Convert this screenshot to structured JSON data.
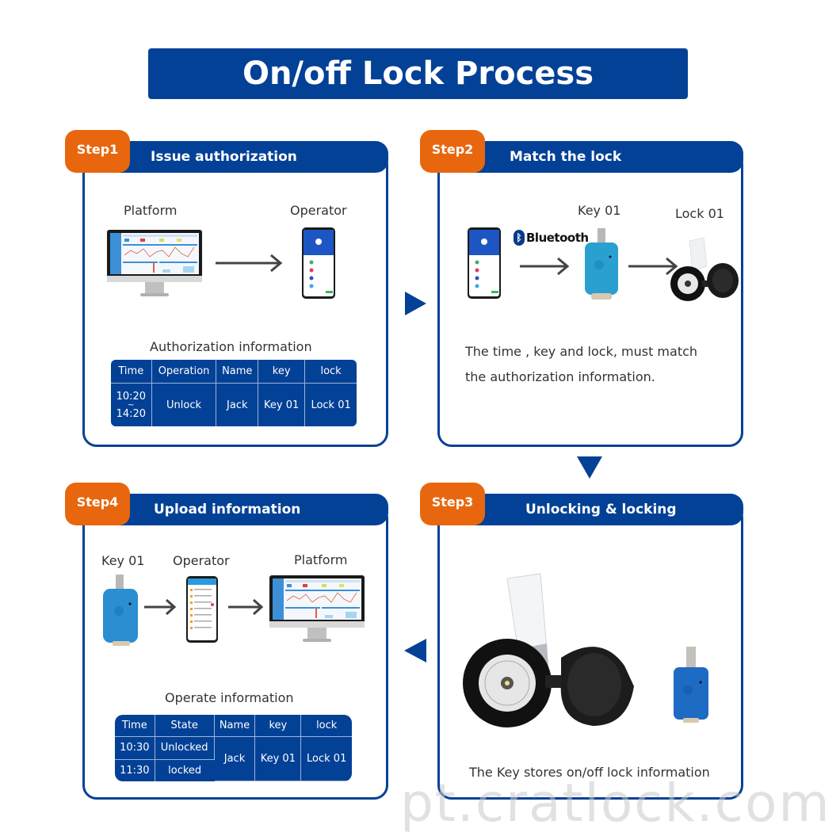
{
  "title": "On/off Lock Process",
  "colors": {
    "primary": "#034196",
    "accent": "#e8670e"
  },
  "steps": [
    {
      "badge": "Step1",
      "heading": "Issue authorization",
      "labels": {
        "left": "Platform",
        "right": "Operator"
      },
      "table_title": "Authorization information",
      "table": {
        "headers": [
          "Time",
          "Operation",
          "Name",
          "key",
          "lock"
        ],
        "time_start": "10:20",
        "time_sep": "~",
        "time_end": "14:20",
        "operation": "Unlock",
        "name": "Jack",
        "key": "Key 01",
        "lock": "Lock 01"
      }
    },
    {
      "badge": "Step2",
      "heading": "Match the lock",
      "bluetooth_label": "Bluetooth",
      "labels": {
        "key": "Key 01",
        "lock": "Lock 01"
      },
      "text_line1": "The time , key and lock, must match",
      "text_line2": "the authorization information."
    },
    {
      "badge": "Step3",
      "heading": "Unlocking &  locking",
      "caption": "The Key stores on/off lock information"
    },
    {
      "badge": "Step4",
      "heading": "Upload information",
      "labels": {
        "key": "Key 01",
        "operator": "Operator",
        "platform": "Platform"
      },
      "table_title": "Operate information",
      "table": {
        "headers": [
          "Time",
          "State",
          "Name",
          "key",
          "lock"
        ],
        "rows": [
          {
            "time": "10:30",
            "state": "Unlocked"
          },
          {
            "time": "11:30",
            "state": "locked"
          }
        ],
        "name": "Jack",
        "key": "Key 01",
        "lock": "Lock 01"
      }
    }
  ],
  "watermark": "pt.cratlock.com"
}
